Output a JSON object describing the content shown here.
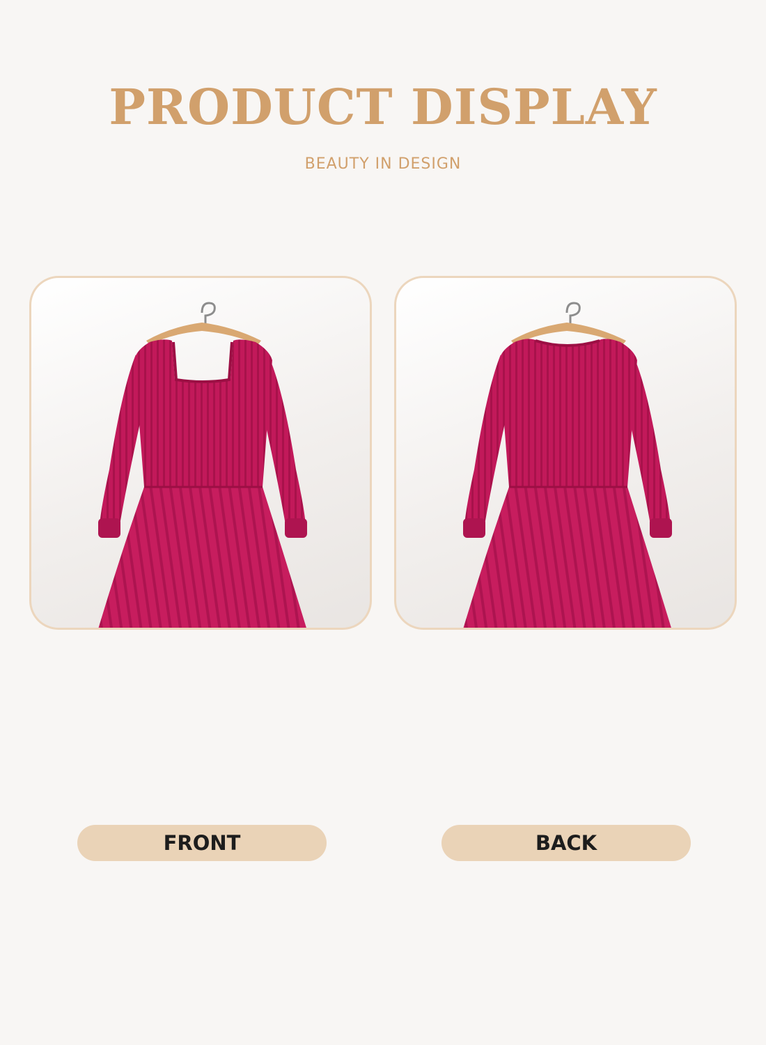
{
  "header": {
    "title": "PRODUCT DISPLAY",
    "subtitle": "BEAUTY IN DESIGN"
  },
  "views": [
    {
      "label": "FRONT",
      "image": "dress-front-image"
    },
    {
      "label": "BACK",
      "image": "dress-back-image"
    }
  ],
  "colors": {
    "accent": "#d1a06c",
    "panel_border": "#ecd6bd",
    "pill": "#ead3b7",
    "dress": "#c21c5a",
    "background": "#f8f6f4"
  }
}
